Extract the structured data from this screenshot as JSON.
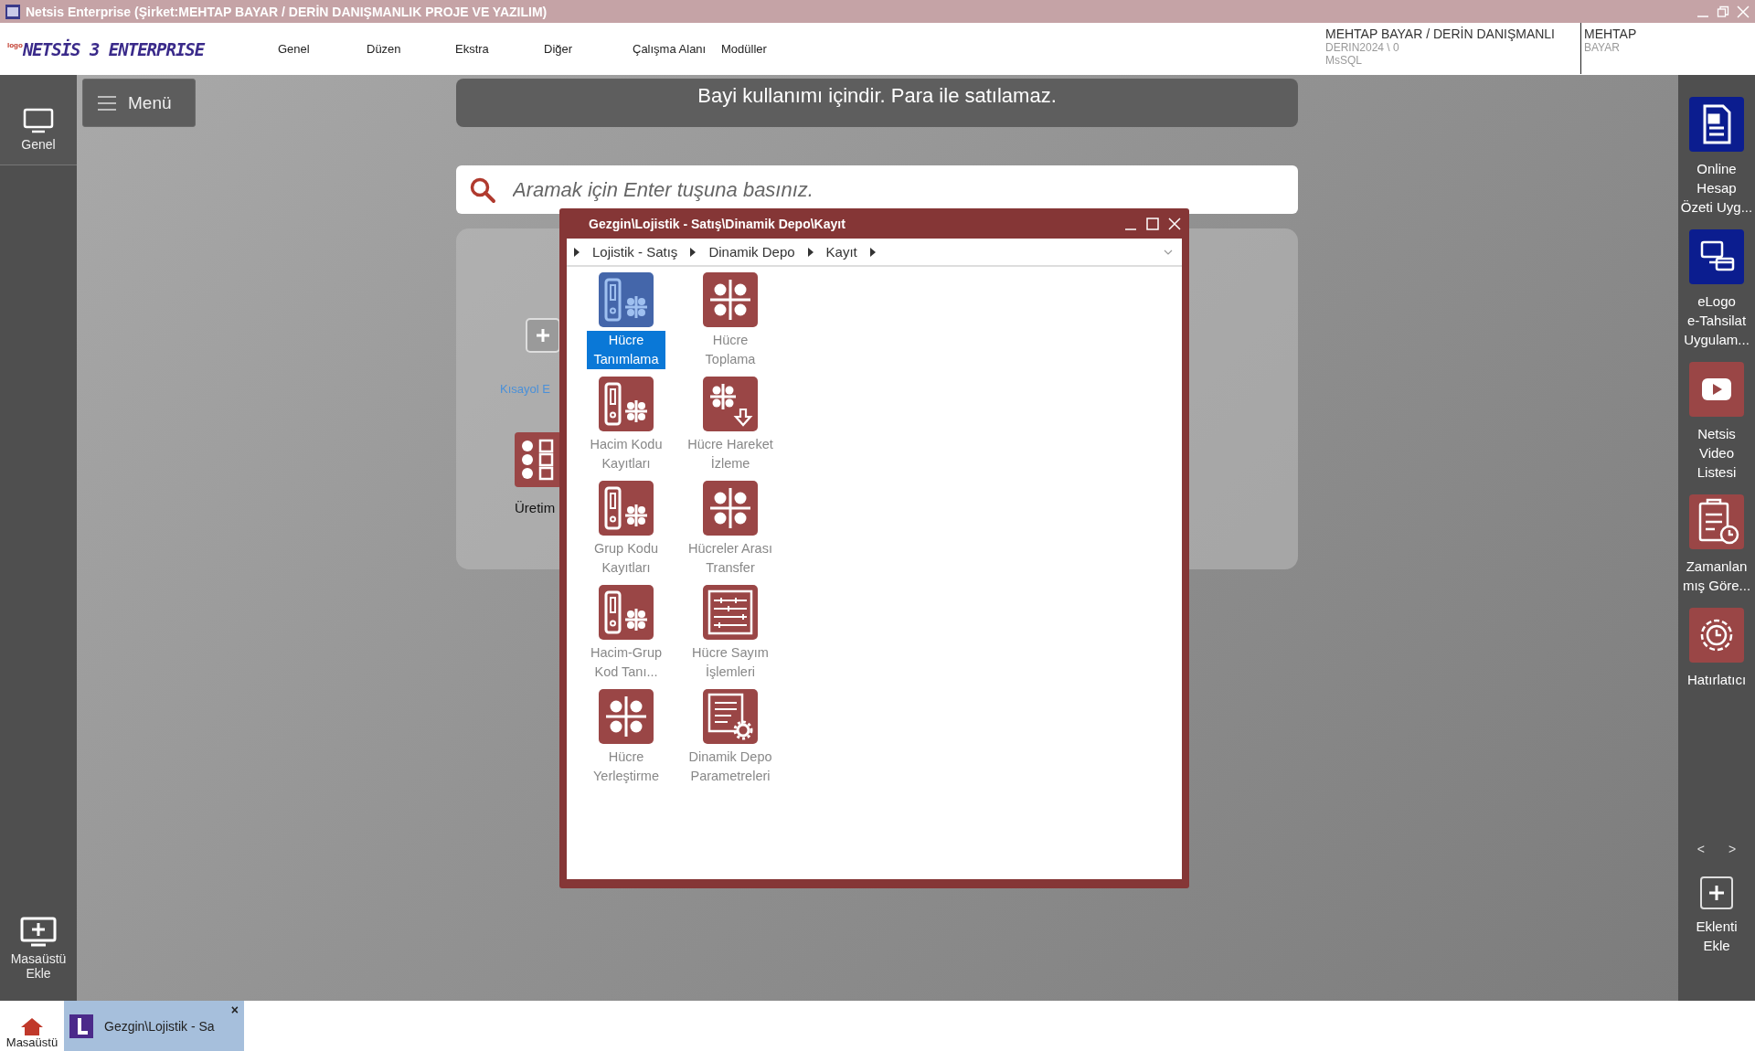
{
  "window": {
    "title": "Netsis Enterprise (Şirket:MEHTAP BAYAR / DERİN DANIŞMANLIK PROJE VE YAZILIM)"
  },
  "header": {
    "logo_mark": "logo",
    "logo": "NETSİS 3 ENTERPRISE",
    "menu": [
      "Genel",
      "Düzen",
      "Ekstra",
      "Diğer",
      "Çalışma Alanı",
      "Modüller"
    ],
    "company": "MEHTAP BAYAR / DERİN DANIŞMANLI",
    "database": "DERIN2024 \\ 0",
    "server": "MsSQL",
    "user_first": "MEHTAP",
    "user_last": "BAYAR"
  },
  "left_sidebar": {
    "items": [
      {
        "label": "Genel",
        "selected": true
      }
    ],
    "add_desktop": "Masaüstü Ekle"
  },
  "menu_button": "Menü",
  "banner": "Bayi kullanımı içindir. Para ile satılamaz.",
  "search": {
    "placeholder": "Aramak için Enter tuşuna basınız."
  },
  "shortcuts": [
    {
      "kind": "add",
      "label": "Kısayol E"
    },
    {
      "kind": "module",
      "label": "Üretim"
    }
  ],
  "explorer": {
    "title": "Gezgin\\Lojistik - Satış\\Dinamik Depo\\Kayıt",
    "breadcrumb": [
      "Lojistik - Satış",
      "Dinamik Depo",
      "Kayıt"
    ],
    "items": [
      {
        "label": "Hücre\nTanımlama",
        "kind": "rack",
        "selected": true
      },
      {
        "label": "Hücre\nToplama",
        "kind": "grid",
        "selected": false
      },
      {
        "label": "Hacim Kodu\nKayıtları",
        "kind": "rack",
        "selected": false
      },
      {
        "label": "Hücre Hareket\nİzleme",
        "kind": "grid-down",
        "selected": false
      },
      {
        "label": "Grup Kodu\nKayıtları",
        "kind": "rack",
        "selected": false
      },
      {
        "label": "Hücreler Arası\nTransfer",
        "kind": "grid",
        "selected": false
      },
      {
        "label": "Hacim-Grup\nKod Tanı...",
        "kind": "rack",
        "selected": false
      },
      {
        "label": "Hücre Sayım\nİşlemleri",
        "kind": "list",
        "selected": false
      },
      {
        "label": "Hücre\nYerleştirme",
        "kind": "grid",
        "selected": false
      },
      {
        "label": "Dinamik Depo\nParametreleri",
        "kind": "doc-gear",
        "selected": false
      }
    ]
  },
  "right_sidebar": {
    "items": [
      {
        "label": "Online\nHesap\nÖzeti Uyg...",
        "kind": "doc",
        "color": "#0b1d8f"
      },
      {
        "label": "eLogo\ne-Tahsilat\nUygulam...",
        "kind": "payment",
        "color": "#0b1d8f"
      },
      {
        "label": "Netsis\nVideo\nListesi",
        "kind": "video",
        "color": "#9a4646"
      },
      {
        "label": "Zamanlan\nmış Göre...",
        "kind": "clipboard",
        "color": "#9a4646"
      },
      {
        "label": "Hatırlatıcı",
        "kind": "gear",
        "color": "#9a4646"
      }
    ],
    "prev": "<",
    "next": ">",
    "add_plugin": "Eklenti\nEkle"
  },
  "taskbar": {
    "home": "Masaüstü",
    "tabs": [
      {
        "label": "Gezgin\\Lojistik - Sa",
        "selected": true,
        "close": "×"
      }
    ]
  }
}
